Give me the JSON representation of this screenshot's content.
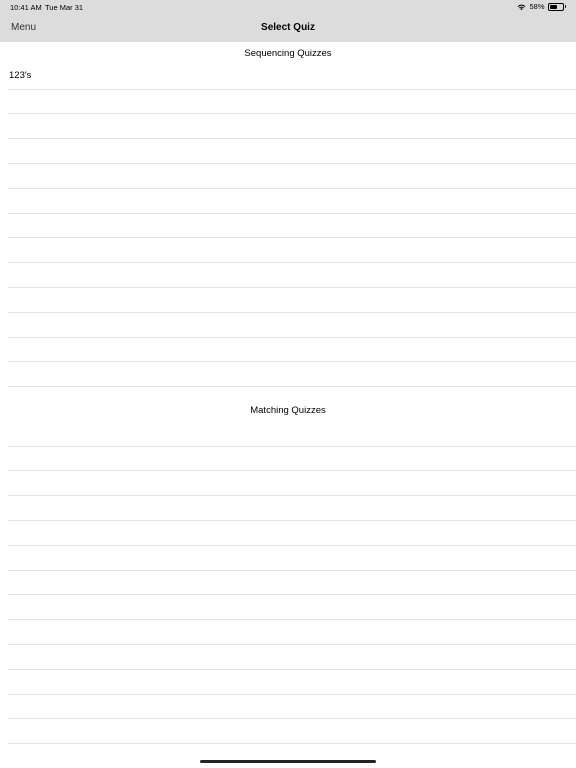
{
  "status_bar": {
    "time": "10:41 AM",
    "date": "Tue Mar 31",
    "battery_percent": "58%",
    "battery_level": 0.58,
    "icons": [
      "wifi-icon",
      "battery-icon"
    ]
  },
  "nav": {
    "menu_label": "Menu",
    "title": "Select Quiz"
  },
  "sections": [
    {
      "header": "Sequencing Quizzes",
      "rows": [
        "123's",
        "",
        "",
        "",
        "",
        "",
        "",
        "",
        "",
        "",
        "",
        "",
        ""
      ]
    },
    {
      "header": "Matching Quizzes",
      "rows": [
        "",
        "",
        "",
        "",
        "",
        "",
        "",
        "",
        "",
        "",
        "",
        "",
        ""
      ]
    }
  ]
}
